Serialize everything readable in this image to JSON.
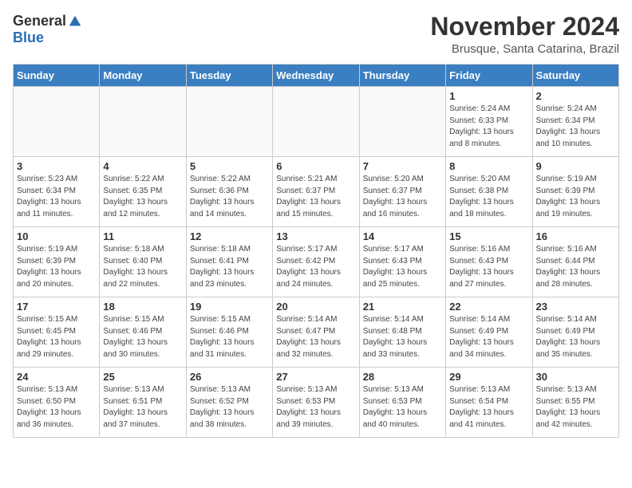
{
  "logo": {
    "general": "General",
    "blue": "Blue"
  },
  "title": "November 2024",
  "location": "Brusque, Santa Catarina, Brazil",
  "headers": [
    "Sunday",
    "Monday",
    "Tuesday",
    "Wednesday",
    "Thursday",
    "Friday",
    "Saturday"
  ],
  "weeks": [
    [
      {
        "day": "",
        "info": ""
      },
      {
        "day": "",
        "info": ""
      },
      {
        "day": "",
        "info": ""
      },
      {
        "day": "",
        "info": ""
      },
      {
        "day": "",
        "info": ""
      },
      {
        "day": "1",
        "info": "Sunrise: 5:24 AM\nSunset: 6:33 PM\nDaylight: 13 hours\nand 8 minutes."
      },
      {
        "day": "2",
        "info": "Sunrise: 5:24 AM\nSunset: 6:34 PM\nDaylight: 13 hours\nand 10 minutes."
      }
    ],
    [
      {
        "day": "3",
        "info": "Sunrise: 5:23 AM\nSunset: 6:34 PM\nDaylight: 13 hours\nand 11 minutes."
      },
      {
        "day": "4",
        "info": "Sunrise: 5:22 AM\nSunset: 6:35 PM\nDaylight: 13 hours\nand 12 minutes."
      },
      {
        "day": "5",
        "info": "Sunrise: 5:22 AM\nSunset: 6:36 PM\nDaylight: 13 hours\nand 14 minutes."
      },
      {
        "day": "6",
        "info": "Sunrise: 5:21 AM\nSunset: 6:37 PM\nDaylight: 13 hours\nand 15 minutes."
      },
      {
        "day": "7",
        "info": "Sunrise: 5:20 AM\nSunset: 6:37 PM\nDaylight: 13 hours\nand 16 minutes."
      },
      {
        "day": "8",
        "info": "Sunrise: 5:20 AM\nSunset: 6:38 PM\nDaylight: 13 hours\nand 18 minutes."
      },
      {
        "day": "9",
        "info": "Sunrise: 5:19 AM\nSunset: 6:39 PM\nDaylight: 13 hours\nand 19 minutes."
      }
    ],
    [
      {
        "day": "10",
        "info": "Sunrise: 5:19 AM\nSunset: 6:39 PM\nDaylight: 13 hours\nand 20 minutes."
      },
      {
        "day": "11",
        "info": "Sunrise: 5:18 AM\nSunset: 6:40 PM\nDaylight: 13 hours\nand 22 minutes."
      },
      {
        "day": "12",
        "info": "Sunrise: 5:18 AM\nSunset: 6:41 PM\nDaylight: 13 hours\nand 23 minutes."
      },
      {
        "day": "13",
        "info": "Sunrise: 5:17 AM\nSunset: 6:42 PM\nDaylight: 13 hours\nand 24 minutes."
      },
      {
        "day": "14",
        "info": "Sunrise: 5:17 AM\nSunset: 6:43 PM\nDaylight: 13 hours\nand 25 minutes."
      },
      {
        "day": "15",
        "info": "Sunrise: 5:16 AM\nSunset: 6:43 PM\nDaylight: 13 hours\nand 27 minutes."
      },
      {
        "day": "16",
        "info": "Sunrise: 5:16 AM\nSunset: 6:44 PM\nDaylight: 13 hours\nand 28 minutes."
      }
    ],
    [
      {
        "day": "17",
        "info": "Sunrise: 5:15 AM\nSunset: 6:45 PM\nDaylight: 13 hours\nand 29 minutes."
      },
      {
        "day": "18",
        "info": "Sunrise: 5:15 AM\nSunset: 6:46 PM\nDaylight: 13 hours\nand 30 minutes."
      },
      {
        "day": "19",
        "info": "Sunrise: 5:15 AM\nSunset: 6:46 PM\nDaylight: 13 hours\nand 31 minutes."
      },
      {
        "day": "20",
        "info": "Sunrise: 5:14 AM\nSunset: 6:47 PM\nDaylight: 13 hours\nand 32 minutes."
      },
      {
        "day": "21",
        "info": "Sunrise: 5:14 AM\nSunset: 6:48 PM\nDaylight: 13 hours\nand 33 minutes."
      },
      {
        "day": "22",
        "info": "Sunrise: 5:14 AM\nSunset: 6:49 PM\nDaylight: 13 hours\nand 34 minutes."
      },
      {
        "day": "23",
        "info": "Sunrise: 5:14 AM\nSunset: 6:49 PM\nDaylight: 13 hours\nand 35 minutes."
      }
    ],
    [
      {
        "day": "24",
        "info": "Sunrise: 5:13 AM\nSunset: 6:50 PM\nDaylight: 13 hours\nand 36 minutes."
      },
      {
        "day": "25",
        "info": "Sunrise: 5:13 AM\nSunset: 6:51 PM\nDaylight: 13 hours\nand 37 minutes."
      },
      {
        "day": "26",
        "info": "Sunrise: 5:13 AM\nSunset: 6:52 PM\nDaylight: 13 hours\nand 38 minutes."
      },
      {
        "day": "27",
        "info": "Sunrise: 5:13 AM\nSunset: 6:53 PM\nDaylight: 13 hours\nand 39 minutes."
      },
      {
        "day": "28",
        "info": "Sunrise: 5:13 AM\nSunset: 6:53 PM\nDaylight: 13 hours\nand 40 minutes."
      },
      {
        "day": "29",
        "info": "Sunrise: 5:13 AM\nSunset: 6:54 PM\nDaylight: 13 hours\nand 41 minutes."
      },
      {
        "day": "30",
        "info": "Sunrise: 5:13 AM\nSunset: 6:55 PM\nDaylight: 13 hours\nand 42 minutes."
      }
    ]
  ]
}
